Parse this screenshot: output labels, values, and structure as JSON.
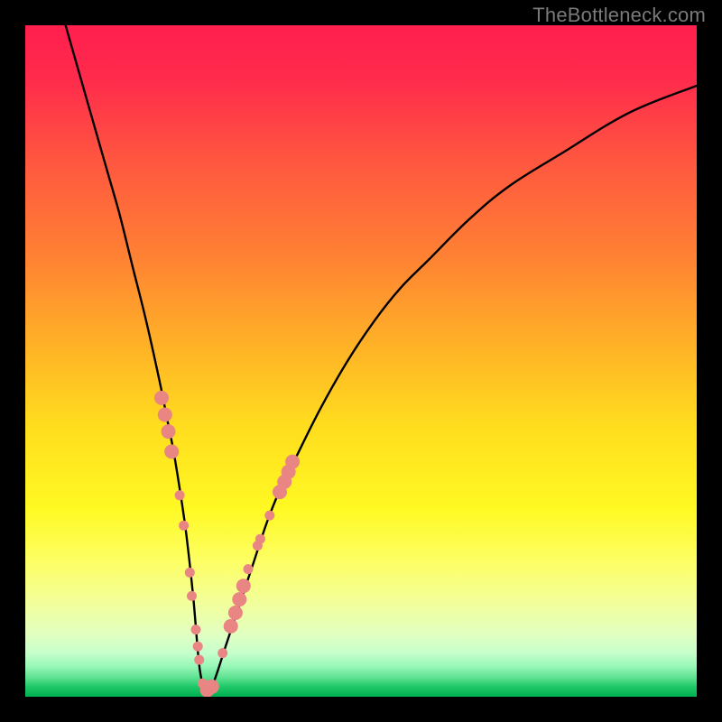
{
  "watermark": {
    "text": "TheBottleneck.com"
  },
  "chart_data": {
    "type": "line",
    "title": "",
    "xlabel": "",
    "ylabel": "",
    "xlim": [
      0,
      100
    ],
    "ylim": [
      0,
      100
    ],
    "series": [
      {
        "name": "bottleneck-curve",
        "x": [
          6,
          8,
          10,
          12,
          14,
          16,
          18,
          20,
          21,
          22,
          23,
          24,
          25,
          26,
          27,
          28,
          30,
          32,
          34,
          36,
          38,
          40,
          44,
          48,
          52,
          56,
          60,
          66,
          72,
          80,
          90,
          100
        ],
        "values": [
          100,
          93,
          86,
          79,
          72,
          64,
          56,
          47,
          42,
          37,
          31,
          24,
          15,
          4,
          1,
          2,
          8,
          14,
          20,
          26,
          31,
          35,
          43,
          50,
          56,
          61,
          65,
          71,
          76,
          81,
          87,
          91
        ]
      }
    ],
    "markers": {
      "name": "data-point-dots",
      "color": "#e98583",
      "radius_major": 8,
      "radius_minor": 5.5,
      "points": [
        {
          "x": 20.3,
          "y": 44.5,
          "r": "major"
        },
        {
          "x": 20.8,
          "y": 42.0,
          "r": "major"
        },
        {
          "x": 21.3,
          "y": 39.5,
          "r": "major"
        },
        {
          "x": 21.8,
          "y": 36.5,
          "r": "major"
        },
        {
          "x": 23.0,
          "y": 30.0,
          "r": "minor"
        },
        {
          "x": 23.6,
          "y": 25.5,
          "r": "minor"
        },
        {
          "x": 24.5,
          "y": 18.5,
          "r": "minor"
        },
        {
          "x": 24.8,
          "y": 15.0,
          "r": "minor"
        },
        {
          "x": 25.4,
          "y": 10.0,
          "r": "minor"
        },
        {
          "x": 25.7,
          "y": 7.5,
          "r": "minor"
        },
        {
          "x": 25.9,
          "y": 5.5,
          "r": "minor"
        },
        {
          "x": 26.4,
          "y": 2.0,
          "r": "minor"
        },
        {
          "x": 27.1,
          "y": 1.0,
          "r": "major"
        },
        {
          "x": 27.8,
          "y": 1.5,
          "r": "major"
        },
        {
          "x": 29.4,
          "y": 6.5,
          "r": "minor"
        },
        {
          "x": 30.6,
          "y": 10.5,
          "r": "major"
        },
        {
          "x": 31.3,
          "y": 12.5,
          "r": "major"
        },
        {
          "x": 31.9,
          "y": 14.5,
          "r": "major"
        },
        {
          "x": 32.5,
          "y": 16.5,
          "r": "major"
        },
        {
          "x": 33.2,
          "y": 19.0,
          "r": "minor"
        },
        {
          "x": 34.6,
          "y": 22.5,
          "r": "minor"
        },
        {
          "x": 35.0,
          "y": 23.5,
          "r": "minor"
        },
        {
          "x": 36.4,
          "y": 27.0,
          "r": "minor"
        },
        {
          "x": 37.9,
          "y": 30.5,
          "r": "major"
        },
        {
          "x": 38.6,
          "y": 32.0,
          "r": "major"
        },
        {
          "x": 39.2,
          "y": 33.5,
          "r": "major"
        },
        {
          "x": 39.8,
          "y": 35.0,
          "r": "major"
        }
      ]
    },
    "gradient_stops": [
      {
        "offset": 0.0,
        "color": "#ff1f4e"
      },
      {
        "offset": 0.08,
        "color": "#ff2b4c"
      },
      {
        "offset": 0.2,
        "color": "#ff5640"
      },
      {
        "offset": 0.34,
        "color": "#ff8034"
      },
      {
        "offset": 0.48,
        "color": "#ffb326"
      },
      {
        "offset": 0.6,
        "color": "#ffde1e"
      },
      {
        "offset": 0.72,
        "color": "#fff923"
      },
      {
        "offset": 0.8,
        "color": "#fdff66"
      },
      {
        "offset": 0.86,
        "color": "#f2ff9a"
      },
      {
        "offset": 0.905,
        "color": "#e3ffc0"
      },
      {
        "offset": 0.935,
        "color": "#c6ffcc"
      },
      {
        "offset": 0.955,
        "color": "#97f7b6"
      },
      {
        "offset": 0.972,
        "color": "#5de191"
      },
      {
        "offset": 0.985,
        "color": "#1fc768"
      },
      {
        "offset": 1.0,
        "color": "#00b050"
      }
    ]
  }
}
